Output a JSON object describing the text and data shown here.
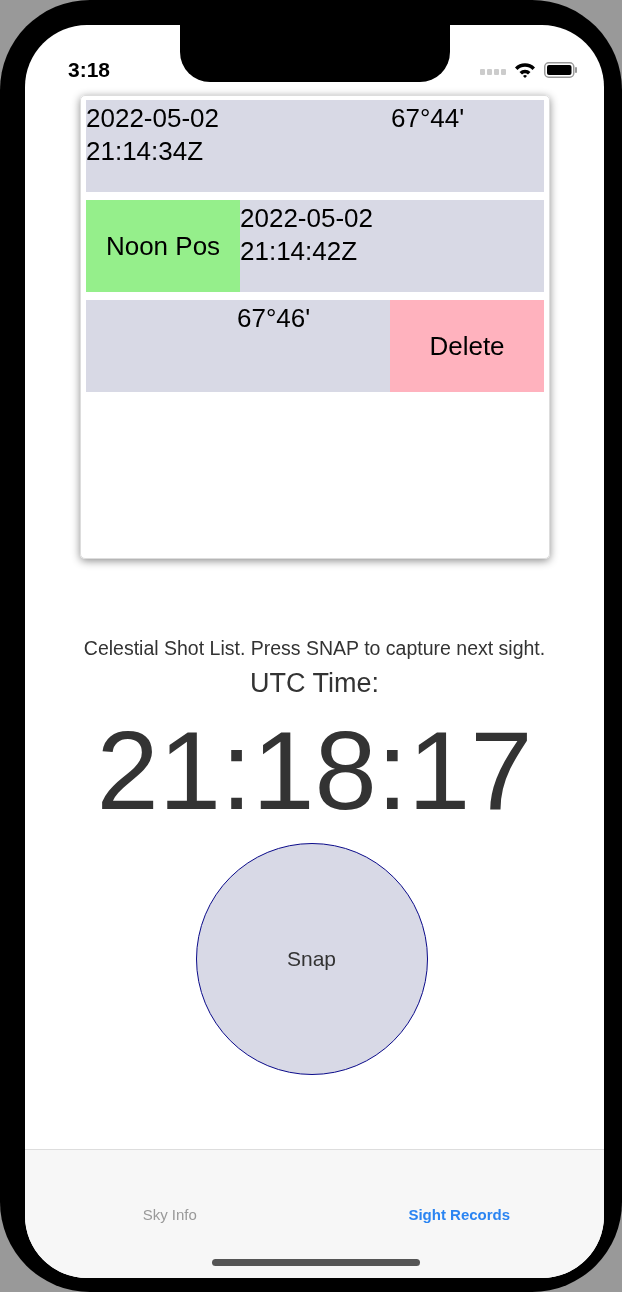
{
  "status_bar": {
    "time": "3:18"
  },
  "shot_list": {
    "rows": [
      {
        "lines": [
          "2022-05-02",
          "21:14:34Z"
        ],
        "angle": "67°44'"
      },
      {
        "lines": [
          "2022-05-02",
          "21:14:42Z"
        ],
        "action": {
          "kind": "leading",
          "label": "Noon Pos"
        }
      },
      {
        "lines": [],
        "angle": "67°46'",
        "action": {
          "kind": "trailing",
          "label": "Delete"
        }
      }
    ]
  },
  "hint": "Celestial Shot List. Press SNAP to capture next sight.",
  "clock_label": "UTC Time:",
  "clock": "21:18:17",
  "snap_button": "Snap",
  "tabs": [
    {
      "label": "Sky Info",
      "selected": false
    },
    {
      "label": "Sight Records",
      "selected": true
    }
  ]
}
